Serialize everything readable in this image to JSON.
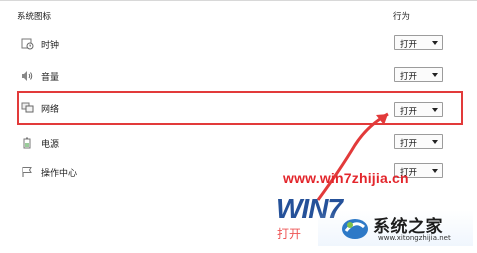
{
  "header": {
    "system_icons": "系统图标",
    "behavior": "行为"
  },
  "rows": [
    {
      "label": "时钟",
      "icon": "clock-icon",
      "value": "打开"
    },
    {
      "label": "音量",
      "icon": "volume-icon",
      "value": "打开"
    },
    {
      "label": "网络",
      "icon": "network-icon",
      "value": "打开"
    },
    {
      "label": "电源",
      "icon": "power-icon",
      "value": "打开"
    },
    {
      "label": "操作中心",
      "icon": "flag-icon",
      "value": "打开"
    }
  ],
  "highlight_color": "#e23a3a",
  "watermark": {
    "url": "www.win7zhijia.cn",
    "logo_text": "WIN7",
    "sub_text": "打开",
    "site_name": "系统之家",
    "site_url": "www.xitongzhijia.net"
  }
}
